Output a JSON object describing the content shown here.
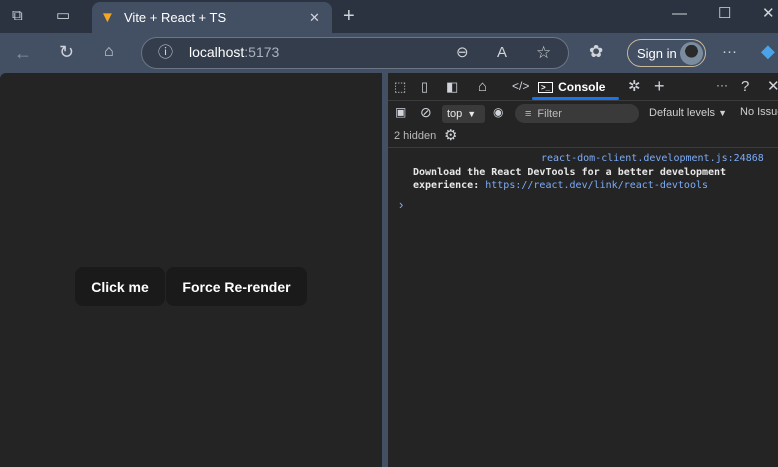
{
  "browser": {
    "tab_title": "Vite + React + TS",
    "url_host": "localhost",
    "url_port": ":5173",
    "signin_label": "Sign in"
  },
  "page": {
    "buttons": [
      "Click me",
      "Force Re-render"
    ]
  },
  "devtools": {
    "console_tab": "Console",
    "context": "top",
    "filter_placeholder": "Filter",
    "levels": "Default levels",
    "issues": "No Issues",
    "hidden": "2 hidden",
    "messages": [
      {
        "source": "react-dom-client.development.js:24868",
        "text": "Download the React DevTools for a better development experience: ",
        "link": "https://react.dev/link/react-devtools"
      }
    ],
    "prompt": "›"
  }
}
